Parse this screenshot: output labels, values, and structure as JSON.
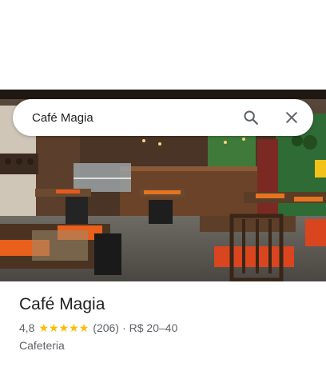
{
  "search": {
    "value": "Café Magia"
  },
  "place": {
    "name": "Café Magia",
    "rating": "4,8",
    "stars": [
      "★",
      "★",
      "★",
      "★",
      "★"
    ],
    "reviews": "(206)",
    "separator": "·",
    "price": "R$ 20–40",
    "category": "Cafeteria"
  },
  "colors": {
    "star": "#fbbc04",
    "text_primary": "#202124",
    "text_secondary": "#5f6368"
  },
  "icons": [
    "search-icon",
    "close-icon"
  ]
}
